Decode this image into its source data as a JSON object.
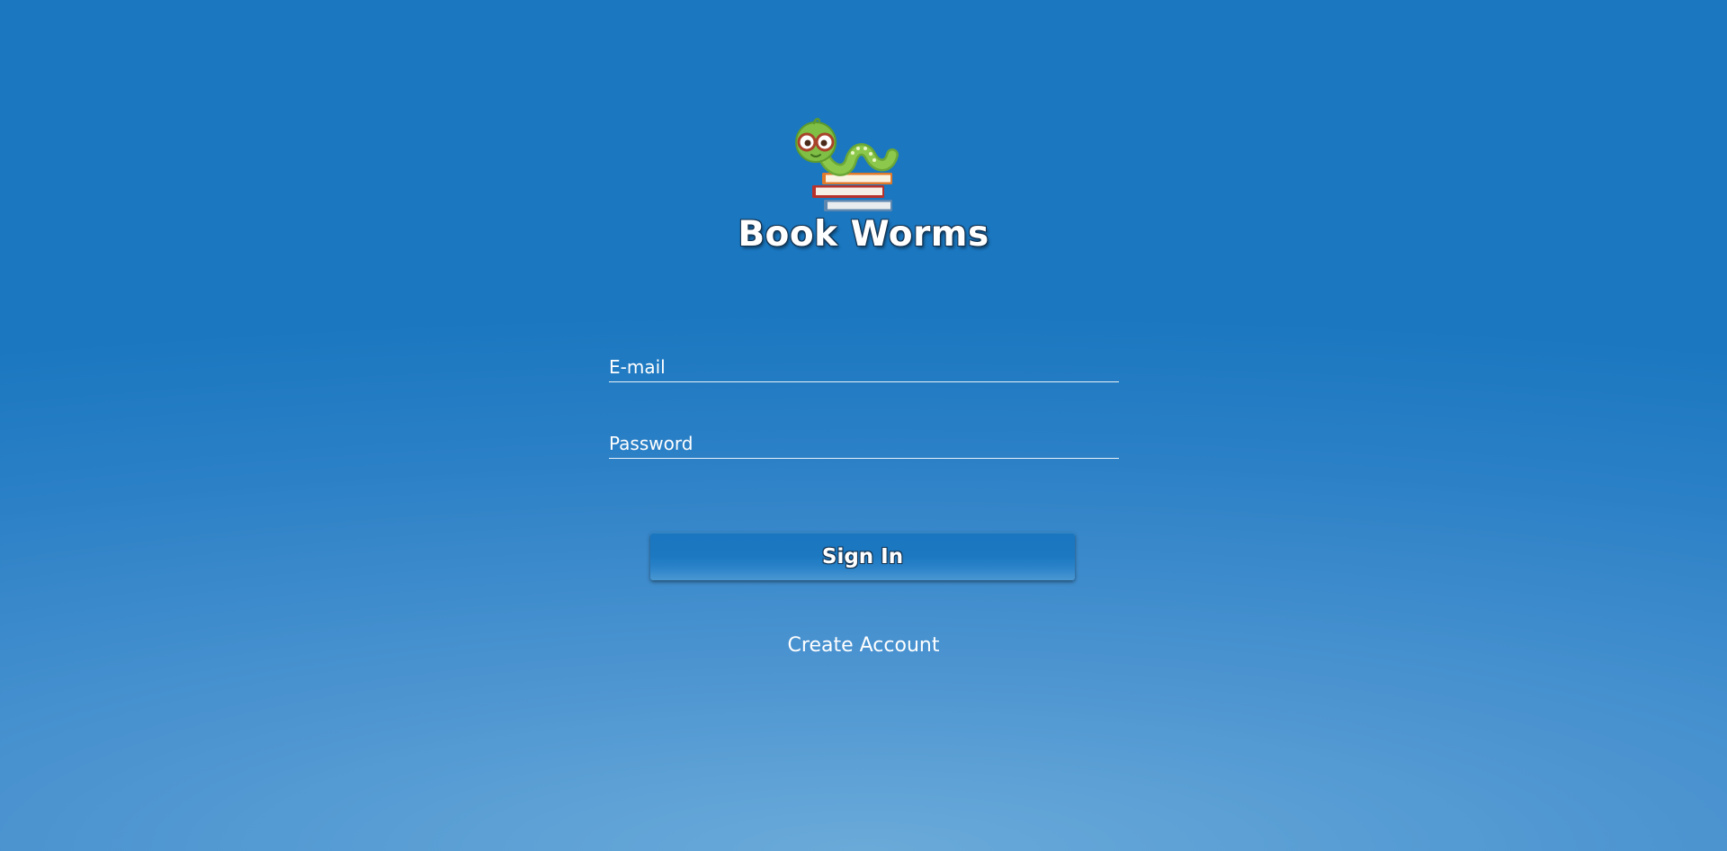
{
  "app": {
    "title": "Book Worms",
    "logo_icon": "bookworm-on-books-icon"
  },
  "form": {
    "email": {
      "placeholder": "E-mail",
      "value": ""
    },
    "password": {
      "placeholder": "Password",
      "value": ""
    },
    "signin_label": "Sign In",
    "create_account_label": "Create Account"
  },
  "colors": {
    "background_top": "#1a77c0",
    "background_bottom": "#6aaad9",
    "text": "#ffffff"
  }
}
